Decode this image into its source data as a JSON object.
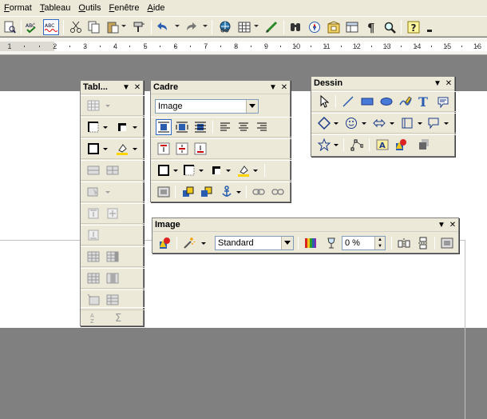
{
  "menu": [
    {
      "label": "Format",
      "ul": "F",
      "rest": "ormat"
    },
    {
      "label": "Tableau",
      "ul": "T",
      "rest": "ableau"
    },
    {
      "label": "Outils",
      "ul": "O",
      "rest": "utils"
    },
    {
      "label": "Fenêtre",
      "ul": "F",
      "rest": "enêtre"
    },
    {
      "label": "Aide",
      "ul": "A",
      "rest": "ide"
    }
  ],
  "ruler": {
    "numbers": [
      "1",
      "2",
      "3",
      "4",
      "5",
      "6",
      "7",
      "8",
      "9",
      "10",
      "11",
      "12",
      "13",
      "14",
      "15",
      "16"
    ]
  },
  "palettes": {
    "table": {
      "title": "Tabl..."
    },
    "frame": {
      "title": "Cadre",
      "combo_value": "Image"
    },
    "drawing": {
      "title": "Dessin"
    },
    "image": {
      "title": "Image",
      "mode_value": "Standard",
      "transparency_value": "0 %"
    }
  },
  "colors": {
    "accent": "#316ac5",
    "toolbar_bg": "#ece9d8",
    "workspace": "#808080"
  }
}
